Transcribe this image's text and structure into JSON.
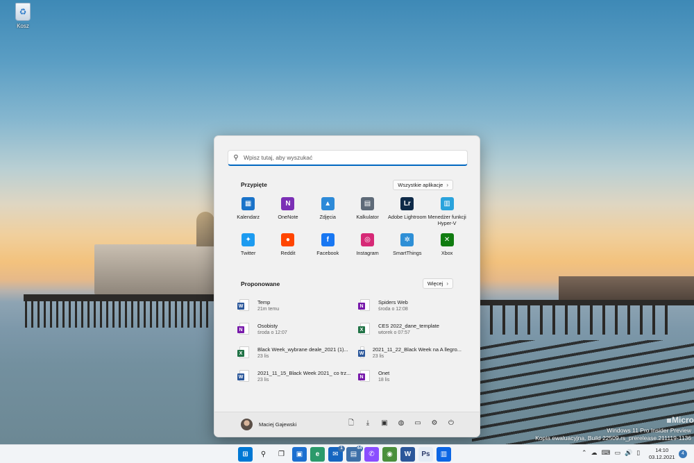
{
  "desktop": {
    "recycle_bin_label": "Kosz",
    "watermark_brand": "Micro",
    "watermark_line1": "Windows 11 Pro Insider Preview",
    "watermark_line2": "Kopia ewaluacyjna. Build 22509.rs_prerelease.211119-1136"
  },
  "start": {
    "search_placeholder": "Wpisz tutaj, aby wyszukać",
    "pinned_title": "Przypięte",
    "all_apps_label": "Wszystkie aplikacje",
    "pinned": [
      {
        "label": "Kalendarz",
        "icon": "calendar-icon",
        "color": "#1a73c9"
      },
      {
        "label": "OneNote",
        "icon": "onenote-icon",
        "color": "#7b2fb5"
      },
      {
        "label": "Zdjęcia",
        "icon": "photos-icon",
        "color": "#2d8ad8"
      },
      {
        "label": "Kalkulator",
        "icon": "calculator-icon",
        "color": "#5e6a78"
      },
      {
        "label": "Adobe Lightroom",
        "icon": "lightroom-icon",
        "color": "#0e2a48"
      },
      {
        "label": "Menedżer funkcji Hyper-V",
        "icon": "hyperv-icon",
        "color": "#2aa3dc"
      },
      {
        "label": "Twitter",
        "icon": "twitter-icon",
        "color": "#1d9bf0"
      },
      {
        "label": "Reddit",
        "icon": "reddit-icon",
        "color": "#ff4500"
      },
      {
        "label": "Facebook",
        "icon": "facebook-icon",
        "color": "#1877f2"
      },
      {
        "label": "Instagram",
        "icon": "instagram-icon",
        "color": "#d62976"
      },
      {
        "label": "SmartThings",
        "icon": "smartthings-icon",
        "color": "#2e8fd6"
      },
      {
        "label": "Xbox",
        "icon": "xbox-icon",
        "color": "#107c10"
      }
    ],
    "recommended_title": "Proponowane",
    "more_label": "Więcej",
    "recommended": [
      {
        "name": "Temp",
        "time": "21m temu",
        "type": "word"
      },
      {
        "name": "Spiders Web",
        "time": "środa o 12:08",
        "type": "onenote"
      },
      {
        "name": "Osobisty",
        "time": "środa o 12:07",
        "type": "onenote"
      },
      {
        "name": "CES 2022_dane_template",
        "time": "wtorek o 07:57",
        "type": "excel"
      },
      {
        "name": "Black Week_wybrane deale_2021 (1)...",
        "time": "23 lis",
        "type": "excel"
      },
      {
        "name": "2021_11_22_Black Week na A llegro...",
        "time": "23 lis",
        "type": "word"
      },
      {
        "name": "2021_11_15_Black Week 2021_ co trz...",
        "time": "23 lis",
        "type": "word"
      },
      {
        "name": "Onet",
        "time": "18 lis",
        "type": "onenote"
      }
    ],
    "user_name": "Maciej Gajewski"
  },
  "taskbar": {
    "apps": [
      {
        "icon": "start-icon",
        "badge": ""
      },
      {
        "icon": "search-icon",
        "badge": ""
      },
      {
        "icon": "task-view-icon",
        "badge": ""
      },
      {
        "icon": "widgets-icon",
        "badge": ""
      },
      {
        "icon": "edge-canary-icon",
        "badge": ""
      },
      {
        "icon": "mail-icon",
        "badge": "1"
      },
      {
        "icon": "store-icon",
        "badge": "44"
      },
      {
        "icon": "messenger-icon",
        "badge": ""
      },
      {
        "icon": "chrome-icon",
        "badge": ""
      },
      {
        "icon": "word-icon",
        "badge": ""
      },
      {
        "icon": "photoshop-icon",
        "badge": ""
      },
      {
        "icon": "trello-icon",
        "badge": ""
      }
    ],
    "time": "14:10",
    "date": "03.12.2021",
    "notification_count": "4"
  },
  "colors": {
    "accent": "#0067c0",
    "word": "#2b579a",
    "excel": "#217346",
    "onenote": "#7719aa"
  }
}
